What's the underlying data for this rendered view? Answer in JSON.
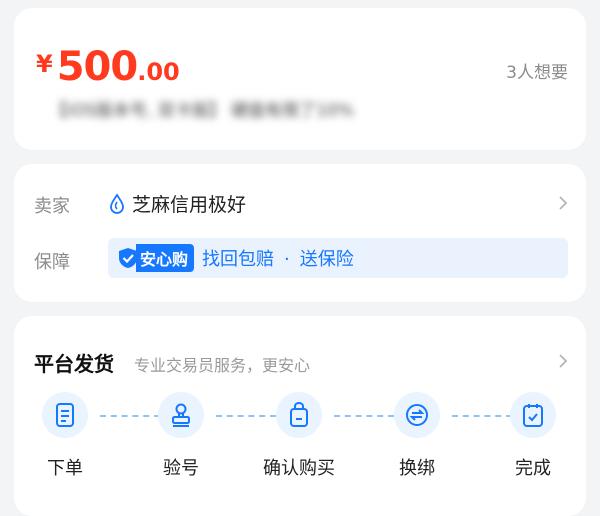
{
  "price": {
    "currency": "¥",
    "integer": "500",
    "decimal": ".00",
    "wants": "3人想要"
  },
  "title_blurred": "【iOS版本号, 双卡版】 硬盘有限了10%",
  "seller": {
    "label": "卖家",
    "credit_text": "芝麻信用极好"
  },
  "guarantee": {
    "label": "保障",
    "badge": "安心购",
    "item1": "找回包赔",
    "dot": "·",
    "item2": "送保险"
  },
  "delivery": {
    "title": "平台发货",
    "subtitle": "专业交易员服务，更安心",
    "steps": [
      "下单",
      "验号",
      "确认购买",
      "换绑",
      "完成"
    ]
  },
  "colors": {
    "price": "#ff3a1e",
    "accent": "#1677ff",
    "icon_bg": "#e9f4ff"
  }
}
